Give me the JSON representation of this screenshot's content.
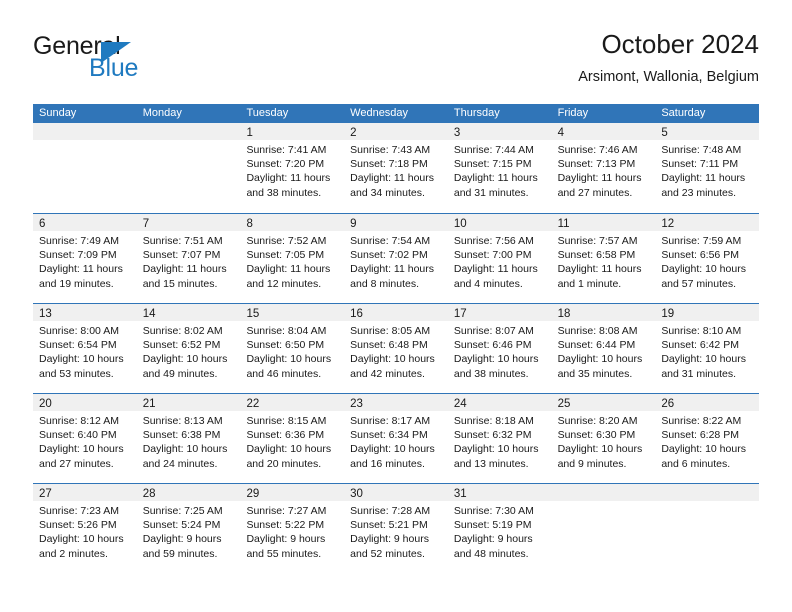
{
  "brand": {
    "name_part1": "General",
    "name_part2": "Blue",
    "triangle_color": "#1f7ac0"
  },
  "header": {
    "title": "October 2024",
    "subtitle": "Arsimont, Wallonia, Belgium"
  },
  "theme": {
    "header_blue": "#3075b8",
    "day_band_gray": "#f0f0f0",
    "text_color": "#1a1a1a"
  },
  "weekdays": [
    "Sunday",
    "Monday",
    "Tuesday",
    "Wednesday",
    "Thursday",
    "Friday",
    "Saturday"
  ],
  "weeks": [
    [
      {
        "day": "",
        "sunrise": "",
        "sunset": "",
        "daylight1": "",
        "daylight2": ""
      },
      {
        "day": "",
        "sunrise": "",
        "sunset": "",
        "daylight1": "",
        "daylight2": ""
      },
      {
        "day": "1",
        "sunrise": "Sunrise: 7:41 AM",
        "sunset": "Sunset: 7:20 PM",
        "daylight1": "Daylight: 11 hours",
        "daylight2": "and 38 minutes."
      },
      {
        "day": "2",
        "sunrise": "Sunrise: 7:43 AM",
        "sunset": "Sunset: 7:18 PM",
        "daylight1": "Daylight: 11 hours",
        "daylight2": "and 34 minutes."
      },
      {
        "day": "3",
        "sunrise": "Sunrise: 7:44 AM",
        "sunset": "Sunset: 7:15 PM",
        "daylight1": "Daylight: 11 hours",
        "daylight2": "and 31 minutes."
      },
      {
        "day": "4",
        "sunrise": "Sunrise: 7:46 AM",
        "sunset": "Sunset: 7:13 PM",
        "daylight1": "Daylight: 11 hours",
        "daylight2": "and 27 minutes."
      },
      {
        "day": "5",
        "sunrise": "Sunrise: 7:48 AM",
        "sunset": "Sunset: 7:11 PM",
        "daylight1": "Daylight: 11 hours",
        "daylight2": "and 23 minutes."
      }
    ],
    [
      {
        "day": "6",
        "sunrise": "Sunrise: 7:49 AM",
        "sunset": "Sunset: 7:09 PM",
        "daylight1": "Daylight: 11 hours",
        "daylight2": "and 19 minutes."
      },
      {
        "day": "7",
        "sunrise": "Sunrise: 7:51 AM",
        "sunset": "Sunset: 7:07 PM",
        "daylight1": "Daylight: 11 hours",
        "daylight2": "and 15 minutes."
      },
      {
        "day": "8",
        "sunrise": "Sunrise: 7:52 AM",
        "sunset": "Sunset: 7:05 PM",
        "daylight1": "Daylight: 11 hours",
        "daylight2": "and 12 minutes."
      },
      {
        "day": "9",
        "sunrise": "Sunrise: 7:54 AM",
        "sunset": "Sunset: 7:02 PM",
        "daylight1": "Daylight: 11 hours",
        "daylight2": "and 8 minutes."
      },
      {
        "day": "10",
        "sunrise": "Sunrise: 7:56 AM",
        "sunset": "Sunset: 7:00 PM",
        "daylight1": "Daylight: 11 hours",
        "daylight2": "and 4 minutes."
      },
      {
        "day": "11",
        "sunrise": "Sunrise: 7:57 AM",
        "sunset": "Sunset: 6:58 PM",
        "daylight1": "Daylight: 11 hours",
        "daylight2": "and 1 minute."
      },
      {
        "day": "12",
        "sunrise": "Sunrise: 7:59 AM",
        "sunset": "Sunset: 6:56 PM",
        "daylight1": "Daylight: 10 hours",
        "daylight2": "and 57 minutes."
      }
    ],
    [
      {
        "day": "13",
        "sunrise": "Sunrise: 8:00 AM",
        "sunset": "Sunset: 6:54 PM",
        "daylight1": "Daylight: 10 hours",
        "daylight2": "and 53 minutes."
      },
      {
        "day": "14",
        "sunrise": "Sunrise: 8:02 AM",
        "sunset": "Sunset: 6:52 PM",
        "daylight1": "Daylight: 10 hours",
        "daylight2": "and 49 minutes."
      },
      {
        "day": "15",
        "sunrise": "Sunrise: 8:04 AM",
        "sunset": "Sunset: 6:50 PM",
        "daylight1": "Daylight: 10 hours",
        "daylight2": "and 46 minutes."
      },
      {
        "day": "16",
        "sunrise": "Sunrise: 8:05 AM",
        "sunset": "Sunset: 6:48 PM",
        "daylight1": "Daylight: 10 hours",
        "daylight2": "and 42 minutes."
      },
      {
        "day": "17",
        "sunrise": "Sunrise: 8:07 AM",
        "sunset": "Sunset: 6:46 PM",
        "daylight1": "Daylight: 10 hours",
        "daylight2": "and 38 minutes."
      },
      {
        "day": "18",
        "sunrise": "Sunrise: 8:08 AM",
        "sunset": "Sunset: 6:44 PM",
        "daylight1": "Daylight: 10 hours",
        "daylight2": "and 35 minutes."
      },
      {
        "day": "19",
        "sunrise": "Sunrise: 8:10 AM",
        "sunset": "Sunset: 6:42 PM",
        "daylight1": "Daylight: 10 hours",
        "daylight2": "and 31 minutes."
      }
    ],
    [
      {
        "day": "20",
        "sunrise": "Sunrise: 8:12 AM",
        "sunset": "Sunset: 6:40 PM",
        "daylight1": "Daylight: 10 hours",
        "daylight2": "and 27 minutes."
      },
      {
        "day": "21",
        "sunrise": "Sunrise: 8:13 AM",
        "sunset": "Sunset: 6:38 PM",
        "daylight1": "Daylight: 10 hours",
        "daylight2": "and 24 minutes."
      },
      {
        "day": "22",
        "sunrise": "Sunrise: 8:15 AM",
        "sunset": "Sunset: 6:36 PM",
        "daylight1": "Daylight: 10 hours",
        "daylight2": "and 20 minutes."
      },
      {
        "day": "23",
        "sunrise": "Sunrise: 8:17 AM",
        "sunset": "Sunset: 6:34 PM",
        "daylight1": "Daylight: 10 hours",
        "daylight2": "and 16 minutes."
      },
      {
        "day": "24",
        "sunrise": "Sunrise: 8:18 AM",
        "sunset": "Sunset: 6:32 PM",
        "daylight1": "Daylight: 10 hours",
        "daylight2": "and 13 minutes."
      },
      {
        "day": "25",
        "sunrise": "Sunrise: 8:20 AM",
        "sunset": "Sunset: 6:30 PM",
        "daylight1": "Daylight: 10 hours",
        "daylight2": "and 9 minutes."
      },
      {
        "day": "26",
        "sunrise": "Sunrise: 8:22 AM",
        "sunset": "Sunset: 6:28 PM",
        "daylight1": "Daylight: 10 hours",
        "daylight2": "and 6 minutes."
      }
    ],
    [
      {
        "day": "27",
        "sunrise": "Sunrise: 7:23 AM",
        "sunset": "Sunset: 5:26 PM",
        "daylight1": "Daylight: 10 hours",
        "daylight2": "and 2 minutes."
      },
      {
        "day": "28",
        "sunrise": "Sunrise: 7:25 AM",
        "sunset": "Sunset: 5:24 PM",
        "daylight1": "Daylight: 9 hours",
        "daylight2": "and 59 minutes."
      },
      {
        "day": "29",
        "sunrise": "Sunrise: 7:27 AM",
        "sunset": "Sunset: 5:22 PM",
        "daylight1": "Daylight: 9 hours",
        "daylight2": "and 55 minutes."
      },
      {
        "day": "30",
        "sunrise": "Sunrise: 7:28 AM",
        "sunset": "Sunset: 5:21 PM",
        "daylight1": "Daylight: 9 hours",
        "daylight2": "and 52 minutes."
      },
      {
        "day": "31",
        "sunrise": "Sunrise: 7:30 AM",
        "sunset": "Sunset: 5:19 PM",
        "daylight1": "Daylight: 9 hours",
        "daylight2": "and 48 minutes."
      },
      {
        "day": "",
        "sunrise": "",
        "sunset": "",
        "daylight1": "",
        "daylight2": ""
      },
      {
        "day": "",
        "sunrise": "",
        "sunset": "",
        "daylight1": "",
        "daylight2": ""
      }
    ]
  ]
}
